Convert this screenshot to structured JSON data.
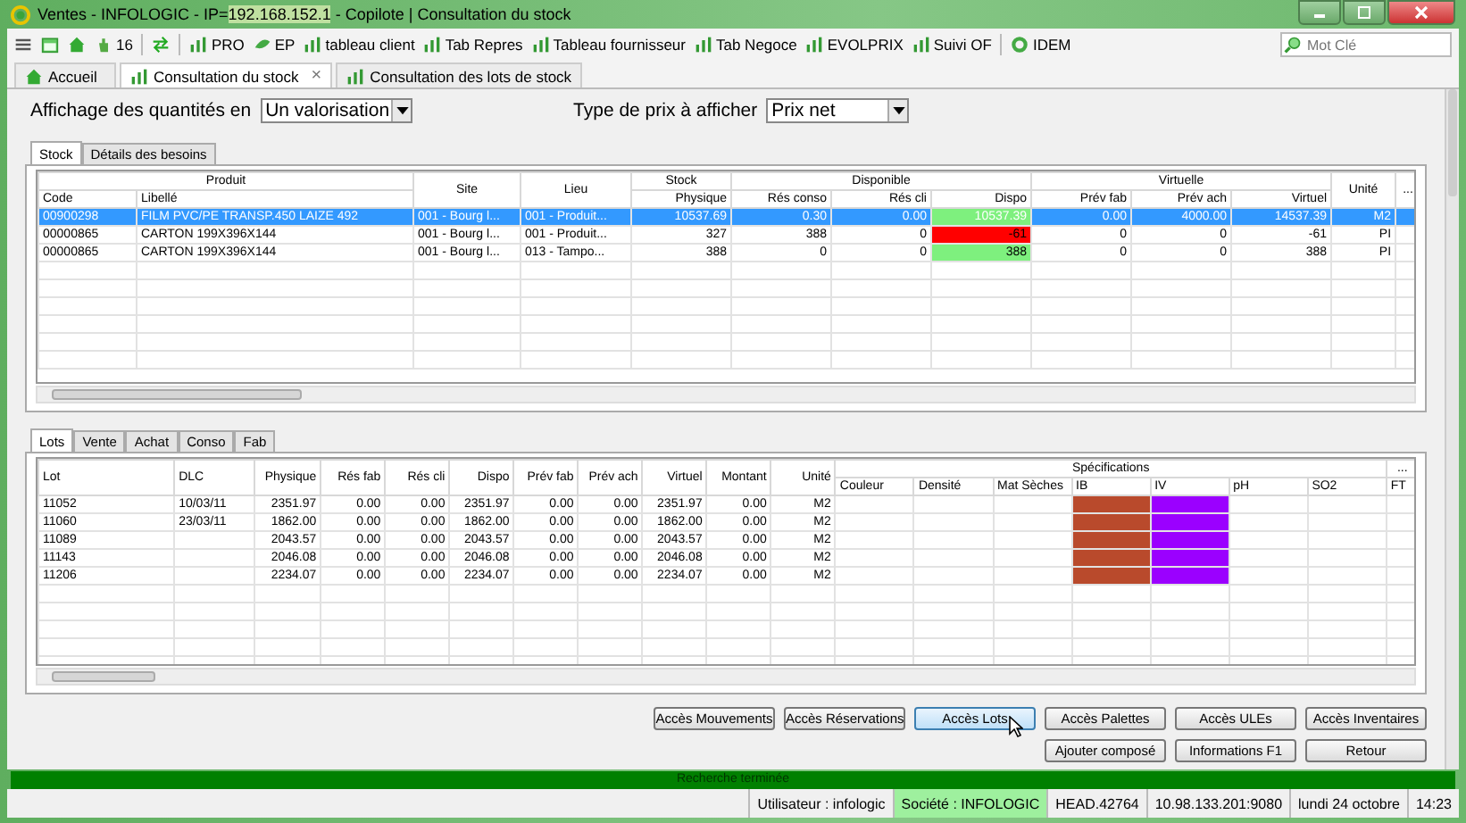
{
  "window": {
    "title_prefix": "Ventes - INFOLOGIC - IP=",
    "ip": "192.168.152.1",
    "title_suffix": " - Copilote | Consultation du stock"
  },
  "toolbar": [
    {
      "kind": "menu"
    },
    {
      "kind": "calendar"
    },
    {
      "kind": "home"
    },
    {
      "kind": "hand",
      "label": "16"
    },
    {
      "kind": "separator"
    },
    {
      "kind": "arrows"
    },
    {
      "kind": "separator"
    },
    {
      "kind": "chart",
      "label": "PRO"
    },
    {
      "kind": "leaf",
      "label": "EP"
    },
    {
      "kind": "chart",
      "label": "tableau client"
    },
    {
      "kind": "chart",
      "label": "Tab Repres"
    },
    {
      "kind": "chart",
      "label": "Tableau fournisseur"
    },
    {
      "kind": "chart",
      "label": "Tab Negoce"
    },
    {
      "kind": "chart",
      "label": "EVOLPRIX"
    },
    {
      "kind": "chart",
      "label": "Suivi OF"
    },
    {
      "kind": "separator"
    },
    {
      "kind": "gear",
      "label": "IDEM"
    }
  ],
  "search": {
    "placeholder": "Mot Clé"
  },
  "doc_tabs": [
    {
      "label": "Accueil",
      "kind": "home",
      "selected": false
    },
    {
      "label": "Consultation du stock",
      "kind": "chart",
      "selected": true,
      "close": "×"
    },
    {
      "label": "Consultation des lots de stock",
      "kind": "chart",
      "selected": false
    }
  ],
  "filters": [
    {
      "label": "Affichage des quantités en",
      "value": "Un valorisation"
    },
    {
      "label": "Type de prix à afficher",
      "value": "Prix net"
    }
  ],
  "stock_tabs": [
    {
      "label": "Stock",
      "selected": true
    },
    {
      "label": "Détails des besoins",
      "selected": false
    }
  ],
  "stock_table": {
    "groups": [
      {
        "label": "Produit",
        "columns": [
          "Code",
          "Libellé"
        ]
      },
      {
        "label": "Site"
      },
      {
        "label": "Lieu"
      },
      {
        "label": "Stock",
        "columns": [
          "Physique"
        ]
      },
      {
        "label": "Disponible",
        "columns": [
          "Rés conso",
          "Rés cli",
          "Dispo"
        ]
      },
      {
        "label": "Virtuelle",
        "columns": [
          "Prév fab",
          "Prév ach",
          "Virtuel"
        ]
      },
      {
        "label": "Unité"
      },
      {
        "label": "..."
      }
    ],
    "rows": [
      {
        "selected": true,
        "cells": [
          "00900298",
          "FILM PVC/PE TRANSP.450 LAIZE 492",
          "001 - Bourg l...",
          "001 - Produit...",
          "10537.69",
          "0.30",
          "0.00",
          {
            "text": "10537.39",
            "color": "#7ef07e"
          },
          "0.00",
          "4000.00",
          "14537.39",
          "M2"
        ]
      },
      {
        "selected": false,
        "cells": [
          "00000865",
          "CARTON 199X396X144",
          "001 - Bourg l...",
          "001 - Produit...",
          "327",
          "388",
          "0",
          {
            "text": "-61",
            "color": "#ff0000"
          },
          "0",
          "0",
          "-61",
          "PI"
        ]
      },
      {
        "selected": false,
        "cells": [
          "00000865",
          "CARTON 199X396X144",
          "001 - Bourg l...",
          "013 - Tampo...",
          "388",
          "0",
          "0",
          {
            "text": "388",
            "color": "#7ef07e"
          },
          "0",
          "0",
          "388",
          "PI"
        ]
      }
    ]
  },
  "lots_tabs": [
    {
      "label": "Lots",
      "selected": true
    },
    {
      "label": "Vente",
      "selected": false
    },
    {
      "label": "Achat",
      "selected": false
    },
    {
      "label": "Conso",
      "selected": false
    },
    {
      "label": "Fab",
      "selected": false
    }
  ],
  "lots_table": {
    "columns": [
      "Lot",
      "DLC",
      "Physique",
      "Rés fab",
      "Rés cli",
      "Dispo",
      "Prév fab",
      "Prév ach",
      "Virtuel",
      "Montant",
      "Unité"
    ],
    "spec_group": "Spécifications",
    "spec_more": "...",
    "spec_columns": [
      "Couleur",
      "Densité",
      "Mat Sèches",
      "IB",
      "IV",
      "pH",
      "SO2",
      "FT"
    ],
    "rows": [
      {
        "lot": "11052",
        "dlc": "10/03/11",
        "values": [
          "2351.97",
          "0.00",
          "0.00",
          "2351.97",
          "0.00",
          "0.00",
          "2351.97",
          "0.00",
          "M2"
        ],
        "ib": {
          "color": "#b94a2c"
        },
        "iv": {
          "color": "#9b00ff"
        }
      },
      {
        "lot": "11060",
        "dlc": "23/03/11",
        "values": [
          "1862.00",
          "0.00",
          "0.00",
          "1862.00",
          "0.00",
          "0.00",
          "1862.00",
          "0.00",
          "M2"
        ],
        "ib": {
          "color": "#b94a2c"
        },
        "iv": {
          "color": "#9b00ff"
        }
      },
      {
        "lot": "11089",
        "values": [
          "2043.57",
          "0.00",
          "0.00",
          "2043.57",
          "0.00",
          "0.00",
          "2043.57",
          "0.00",
          "M2"
        ],
        "ib": {
          "color": "#b94a2c"
        },
        "iv": {
          "color": "#9b00ff"
        }
      },
      {
        "lot": "11143",
        "values": [
          "2046.08",
          "0.00",
          "0.00",
          "2046.08",
          "0.00",
          "0.00",
          "2046.08",
          "0.00",
          "M2"
        ],
        "ib": {
          "color": "#b94a2c"
        },
        "iv": {
          "color": "#9b00ff"
        }
      },
      {
        "lot": "11206",
        "values": [
          "2234.07",
          "0.00",
          "0.00",
          "2234.07",
          "0.00",
          "0.00",
          "2234.07",
          "0.00",
          "M2"
        ],
        "ib": {
          "color": "#b94a2c"
        },
        "iv": {
          "color": "#9b00ff"
        }
      }
    ]
  },
  "buttons_row1": [
    {
      "label": "Accès Mouvements",
      "focused": false
    },
    {
      "label": "Accès Réservations",
      "focused": false
    },
    {
      "label": "Accès Lots",
      "focused": true
    },
    {
      "label": "Accès Palettes",
      "focused": false
    },
    {
      "label": "Accès ULEs",
      "focused": false
    },
    {
      "label": "Accès Inventaires",
      "focused": false
    }
  ],
  "buttons_row2": [
    {
      "label": "Ajouter composé",
      "focused": false
    },
    {
      "label": "Informations F1",
      "focused": false
    },
    {
      "label": "Retour",
      "focused": false
    }
  ],
  "message": "Recherche terminée",
  "status_bar": [
    {
      "text": "Utilisateur : infologic",
      "highlighted": false
    },
    {
      "text": "Société : INFOLOGIC",
      "highlighted": true
    },
    {
      "text": "HEAD.42764",
      "highlighted": false
    },
    {
      "text": "10.98.133.201:9080",
      "highlighted": false
    },
    {
      "text": "lundi 24 octobre",
      "highlighted": false
    },
    {
      "text": "14:23",
      "highlighted": false
    }
  ]
}
